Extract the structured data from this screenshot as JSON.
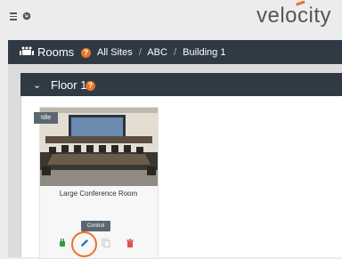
{
  "topbar": {
    "brand": "velocity"
  },
  "breadcrumb": {
    "section_label": "Rooms",
    "help": "?",
    "crumbs": [
      "All Sites",
      "ABC",
      "Building 1"
    ],
    "separator": "/"
  },
  "floor": {
    "label": "Floor 1",
    "help": "?"
  },
  "room": {
    "status": "Idle",
    "name": "Large Conference Room",
    "control_label": "Control"
  },
  "colors": {
    "accent": "#e8732a",
    "header_bg": "#2f3a44",
    "power_green": "#2e9b3a",
    "delete_red": "#d9534f",
    "edit_blue": "#1f6fb5"
  },
  "icons": [
    "menu-icon",
    "globe-icon",
    "rooms-icon",
    "help-icon",
    "chevron-down-icon",
    "power-icon",
    "edit-icon",
    "copy-icon",
    "trash-icon"
  ]
}
